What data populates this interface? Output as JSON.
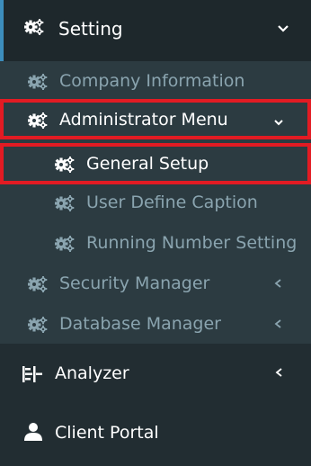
{
  "colors": {
    "sidebar_bg": "#222d32",
    "active_header_bg": "#1e282c",
    "submenu_bg": "#2c3b41",
    "accent": "#3c8dbc",
    "highlight_border": "#e21b23",
    "text_primary": "#ffffff",
    "text_muted": "#8aa4af"
  },
  "menu": {
    "setting": {
      "label": "Setting",
      "icon": "gears-icon",
      "expanded": true
    },
    "submenu": {
      "company_information": {
        "label": "Company Information",
        "icon": "gears-icon"
      },
      "administrator_menu": {
        "label": "Administrator Menu",
        "icon": "gears-icon",
        "expanded": true
      },
      "administrator_items": [
        {
          "label": "General Setup",
          "icon": "gears-icon",
          "active": true
        },
        {
          "label": "User Define Caption",
          "icon": "gears-icon"
        },
        {
          "label": "Running Number Setting",
          "icon": "gears-icon"
        }
      ],
      "security_manager": {
        "label": "Security Manager",
        "icon": "gears-icon"
      },
      "database_manager": {
        "label": "Database Manager",
        "icon": "gears-icon"
      }
    },
    "analyzer": {
      "label": "Analyzer",
      "icon": "analyzer-icon"
    },
    "client_portal": {
      "label": "Client Portal",
      "icon": "user-icon"
    }
  }
}
